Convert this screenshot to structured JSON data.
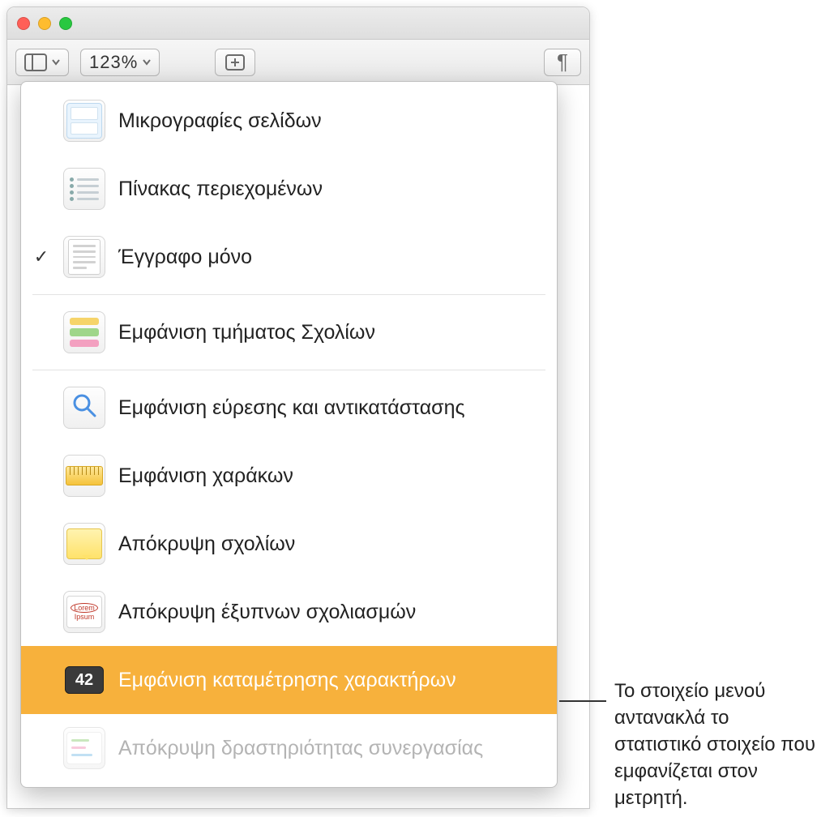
{
  "toolbar": {
    "zoom": "123%"
  },
  "menu": {
    "items": [
      {
        "label": "Μικρογραφίες σελίδων",
        "checked": false,
        "disabled": false
      },
      {
        "label": "Πίνακας περιεχομένων",
        "checked": false,
        "disabled": false
      },
      {
        "label": "Έγγραφο μόνο",
        "checked": true,
        "disabled": false
      },
      {
        "label": "Εμφάνιση τμήματος Σχολίων",
        "checked": false,
        "disabled": false
      },
      {
        "label": "Εμφάνιση εύρεσης και αντικατάστασης",
        "checked": false,
        "disabled": false
      },
      {
        "label": "Εμφάνιση χαράκων",
        "checked": false,
        "disabled": false
      },
      {
        "label": "Απόκρυψη σχολίων",
        "checked": false,
        "disabled": false
      },
      {
        "label": "Απόκρυψη έξυπνων σχολιασμών",
        "checked": false,
        "disabled": false
      },
      {
        "label": "Εμφάνιση καταμέτρησης χαρακτήρων",
        "checked": false,
        "disabled": false,
        "highlighted": true,
        "badge": "42"
      },
      {
        "label": "Απόκρυψη δραστηριότητας συνεργασίας",
        "checked": false,
        "disabled": true
      }
    ]
  },
  "callout": "Το στοιχείο μενού αντανακλά το στατιστικό στοιχείο που εμφανίζεται στον μετρητή."
}
